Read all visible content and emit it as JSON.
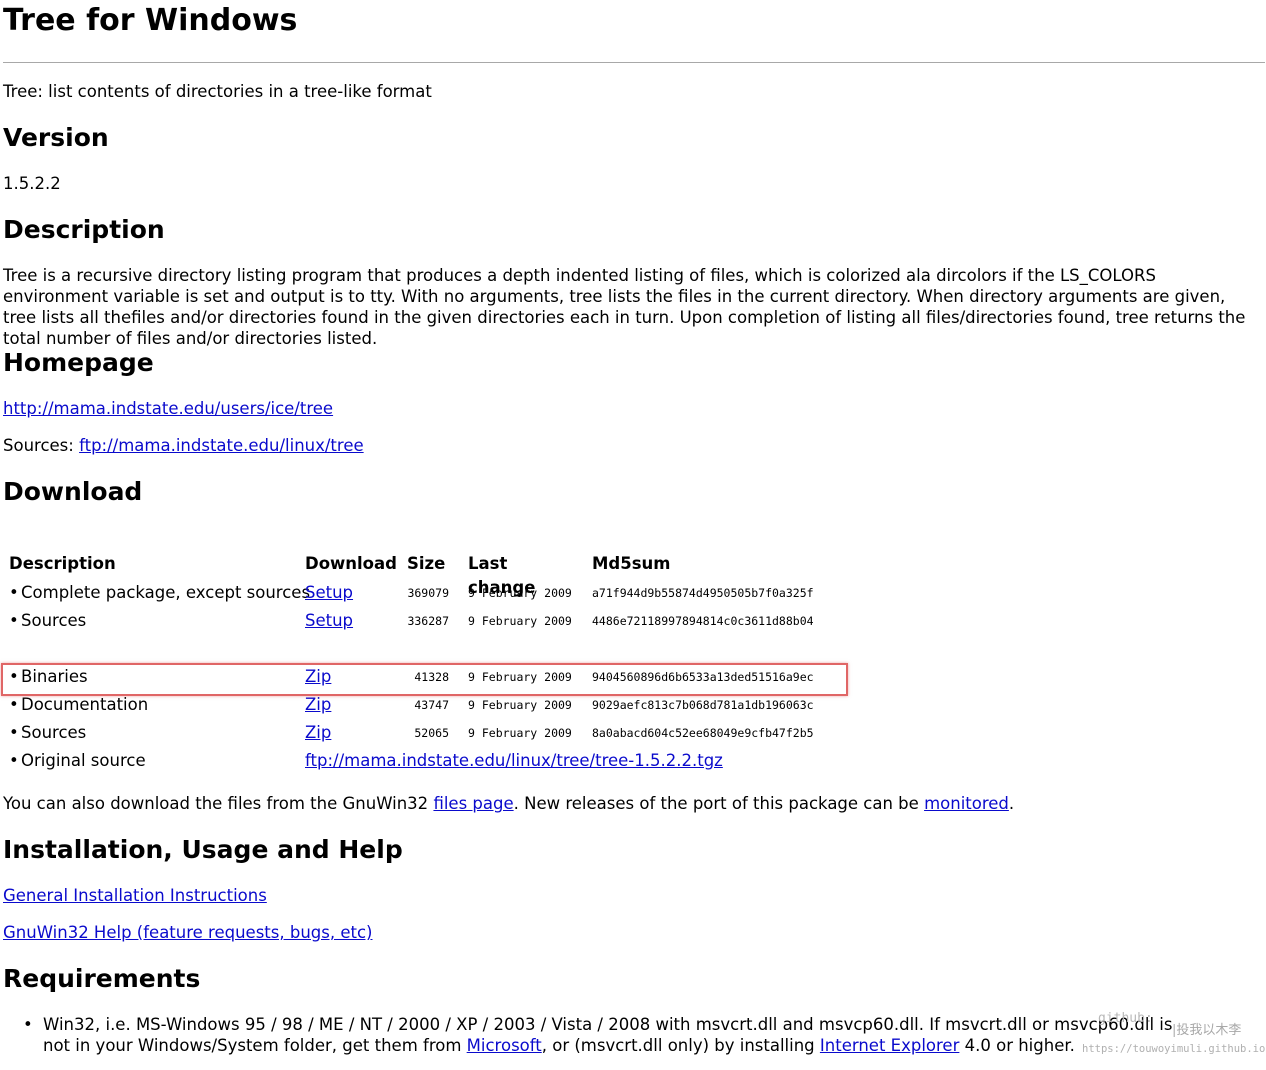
{
  "title": "Tree for Windows",
  "subtitle": "Tree: list contents of directories in a tree-like format",
  "version": {
    "heading": "Version",
    "value": "1.5.2.2"
  },
  "description": {
    "heading": "Description",
    "text": "Tree is a recursive directory listing program that produces a depth indented listing of files, which is colorized ala dircolors if the LS_COLORS environment variable is set and output is to tty. With no arguments, tree lists the files in the current directory. When directory arguments are given, tree lists all thefiles and/or directories found in the given directories each in turn. Upon completion of listing all files/directories found, tree returns the total number of files and/or directories listed."
  },
  "homepage": {
    "heading": "Homepage",
    "url": "http://mama.indstate.edu/users/ice/tree",
    "sources_label": "Sources: ",
    "sources_url": "ftp://mama.indstate.edu/linux/tree"
  },
  "download": {
    "heading": "Download",
    "columns": [
      "Description",
      "Download",
      "Size",
      "Last change",
      "Md5sum"
    ],
    "rows": [
      {
        "bullet": "•",
        "description": "Complete package, except sources",
        "link": "Setup",
        "size": "369079",
        "date": "9 February 2009",
        "md5": "a71f944d9b55874d4950505b7f0a325f"
      },
      {
        "bullet": "•",
        "description": "Sources",
        "link": "Setup",
        "size": "336287",
        "date": "9 February 2009",
        "md5": "4486e72118997894814c0c3611d88b04"
      },
      {
        "bullet": "•",
        "description": "Binaries",
        "link": "Zip",
        "size": "41328",
        "date": "9 February 2009",
        "md5": "9404560896d6b6533a13ded51516a9ec"
      },
      {
        "bullet": "•",
        "description": "Documentation",
        "link": "Zip",
        "size": "43747",
        "date": "9 February 2009",
        "md5": "9029aefc813c7b068d781a1db196063c"
      },
      {
        "bullet": "•",
        "description": "Sources",
        "link": "Zip",
        "size": "52065",
        "date": "9 February 2009",
        "md5": "8a0abacd604c52ee68049e9cfb47f2b5"
      },
      {
        "bullet": "•",
        "description": "Original source",
        "link": "ftp://mama.indstate.edu/linux/tree/tree-1.5.2.2.tgz"
      }
    ],
    "note_prefix": "You can also download the files from the GnuWin32 ",
    "note_link1": "files page",
    "note_middle": ". New releases of the port of this package can be ",
    "note_link2": "monitored",
    "note_suffix": "."
  },
  "install": {
    "heading": "Installation, Usage and Help",
    "link1": "General Installation Instructions",
    "link2": "GnuWin32 Help (feature requests, bugs, etc)"
  },
  "requirements": {
    "heading": "Requirements",
    "bullet": "•",
    "part1": "Win32, i.e. MS-Windows 95 / 98 / ME / NT / 2000 / XP / 2003 / Vista / 2008 with msvcrt.dll and msvcp60.dll. If msvcrt.dll or msvcp60.dll is not in your Windows/System folder, get them from ",
    "link1": "Microsoft",
    "part2": ", or (msvcrt.dll only) by installing ",
    "link2": "Internet Explorer",
    "part3": " 4.0 or higher."
  },
  "watermark": {
    "line1": "github:",
    "line2": "|投我以木李",
    "line3": "https://touwoyimuli.github.io"
  }
}
